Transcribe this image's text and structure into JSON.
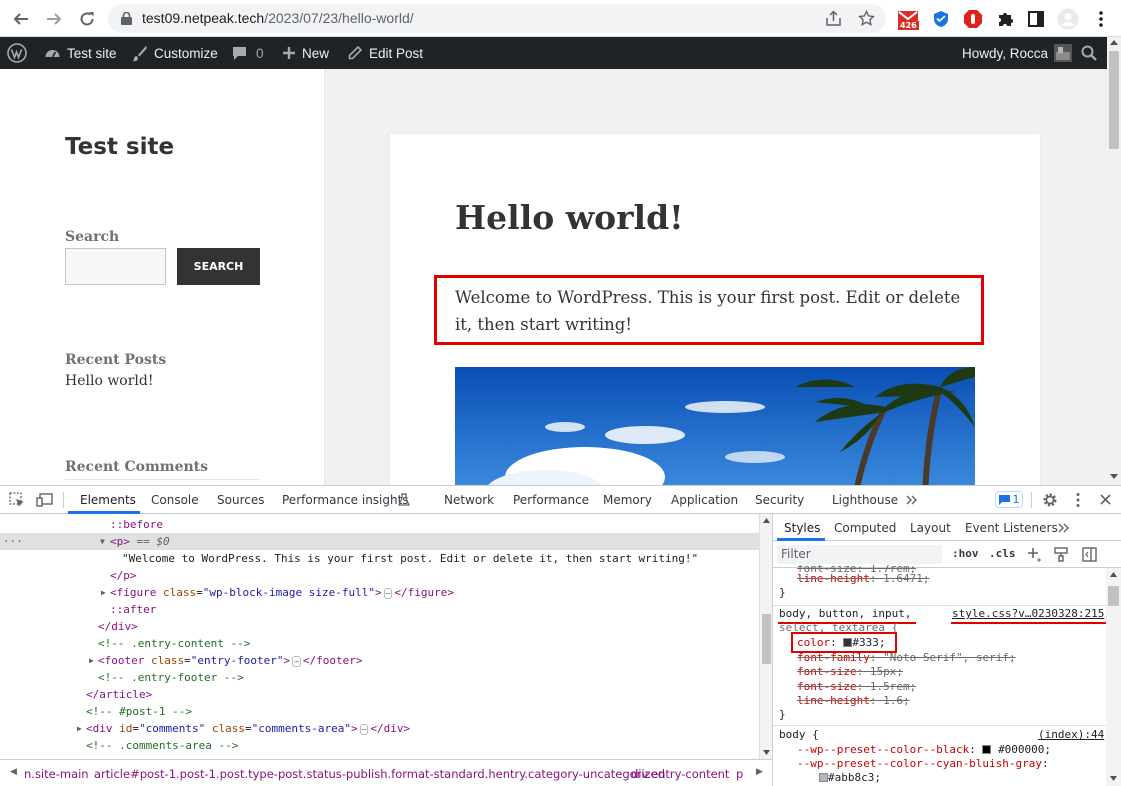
{
  "browser": {
    "url_host": "test09.netpeak.tech",
    "url_path": "/2023/07/23/hello-world/",
    "gmail_badge": "426"
  },
  "admin_bar": {
    "site_name": "Test site",
    "customize": "Customize",
    "comments_count": "0",
    "new": "New",
    "edit_post": "Edit Post",
    "howdy": "Howdy, Rocca"
  },
  "sidebar": {
    "site_title": "Test site",
    "search_label": "Search",
    "search_button": "SEARCH",
    "recent_posts_title": "Recent Posts",
    "recent_post": "Hello world!",
    "recent_comments_title": "Recent Comments"
  },
  "post": {
    "title": "Hello world!",
    "text": "Welcome to WordPress. This is your first post. Edit or delete it, then start writing!"
  },
  "devtools": {
    "tabs": [
      "Elements",
      "Console",
      "Sources",
      "Performance insights",
      "Network",
      "Performance",
      "Memory",
      "Application",
      "Security",
      "Lighthouse"
    ],
    "issues_count": "1",
    "dom": {
      "before": "::before",
      "p_open": "<p>",
      "selected_marker": "== $0",
      "p_text": "\"Welcome to WordPress. This is your first post. Edit or delete it, then start writing!\"",
      "p_close": "</p>",
      "figure_tag": "figure",
      "figure_attr": "class",
      "figure_val": "\"wp-block-image size-full\"",
      "figure_close": "</figure>",
      "after": "::after",
      "div_close": "</div>",
      "cmt_entry_content": "<!-- .entry-content -->",
      "footer_tag": "footer",
      "footer_attr": "class",
      "footer_val": "\"entry-footer\"",
      "footer_close": "</footer>",
      "cmt_entry_footer": "<!-- .entry-footer -->",
      "article_close": "</article>",
      "cmt_post": "<!-- #post-1 -->",
      "comments_tag": "div",
      "comments_id_attr": "id",
      "comments_id_val": "\"comments\"",
      "comments_class_attr": "class",
      "comments_class_val": "\"comments-area\"",
      "comments_close": "</div>",
      "cmt_comments": "<!-- .comments-area -->"
    },
    "breadcrumbs": [
      "n.site-main",
      "article#post-1.post-1.post.type-post.status-publish.format-standard.hentry.category-uncategorized",
      "div.entry-content",
      "p"
    ],
    "styles": {
      "tabs": [
        "Styles",
        "Computed",
        "Layout",
        "Event Listeners"
      ],
      "filter_placeholder": "Filter",
      "hov": ":hov",
      "cls": ".cls",
      "cut_line": "font-size: 1.7rem;",
      "lh_prop": "line-height",
      "lh_val": "1.6471;",
      "close_brace": "}",
      "selector_line1": "body, button, input,",
      "selector_line2": "select, textarea {",
      "source_link": "style.css?v…0230328:215",
      "color_prop": "color",
      "color_val": "#333;",
      "ff_prop": "font-family",
      "ff_val": "\"Noto Serif\", serif;",
      "fs1_prop": "font-size",
      "fs1_val": "15px;",
      "fs2_prop": "font-size",
      "fs2_val": "1.5rem;",
      "lh2_prop": "line-height",
      "lh2_val": "1.6;",
      "body_selector": "body {",
      "index_link": "(index):44",
      "var1_prop": "--wp--preset--color--black",
      "var1_val": "#000000;",
      "var2_prop": "--wp--preset--color--cyan-bluish-gray",
      "var3_val": "#abb8c3;"
    },
    "colors": {
      "swatch_333": "#333333",
      "swatch_black": "#000000",
      "swatch_cyan": "#abb8c3"
    }
  }
}
